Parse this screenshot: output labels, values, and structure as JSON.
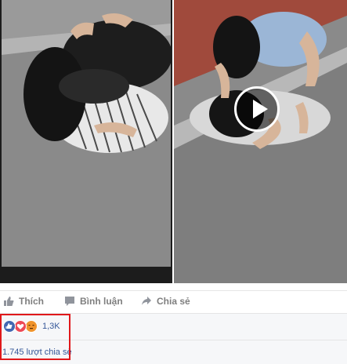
{
  "actions": {
    "like_label": "Thích",
    "comment_label": "Bình luận",
    "share_label": "Chia sẻ"
  },
  "reactions": {
    "types": [
      "like-icon",
      "love-icon",
      "angry-icon"
    ],
    "count": "1,3K"
  },
  "shares": {
    "text": "1.745 lượt chia sẻ"
  },
  "colors": {
    "highlight": "#e0181b",
    "link": "#365899",
    "like": "#4267b2",
    "love": "#ed4956",
    "angry": "#f0932b"
  }
}
